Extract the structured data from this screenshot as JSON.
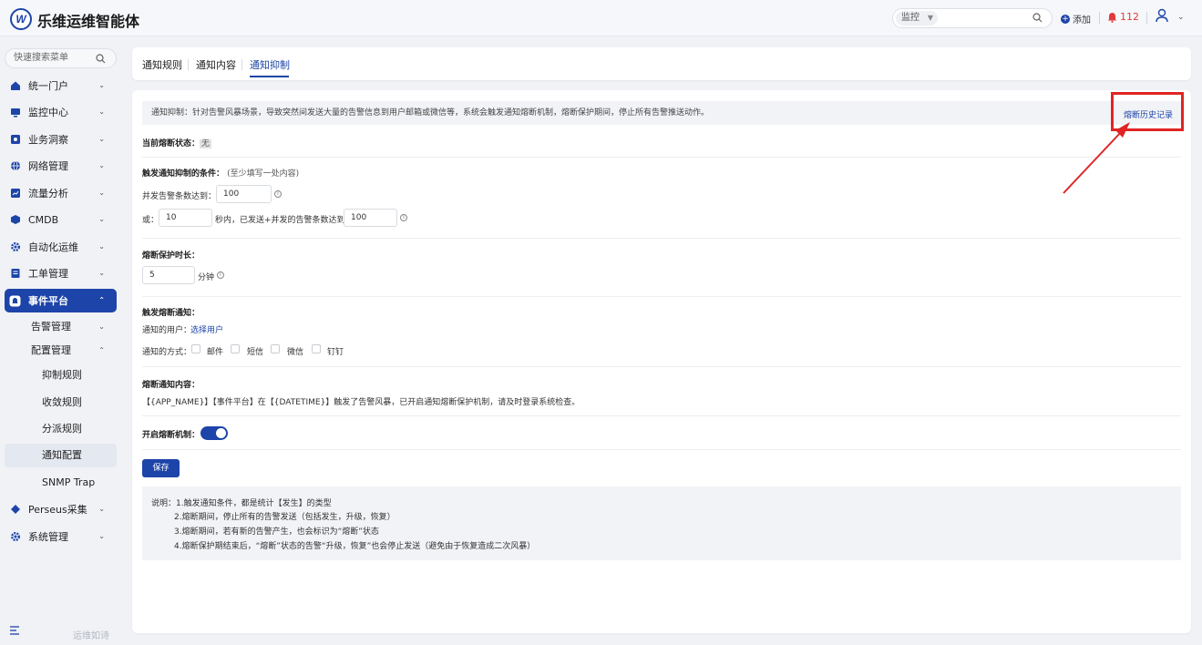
{
  "header": {
    "app_title": "乐维运维智能体",
    "search_scope": "监控",
    "search_placeholder": "",
    "add_label": "添加",
    "alert_count": "112"
  },
  "sidebar": {
    "search_placeholder": "快速搜索菜单",
    "items": [
      {
        "label": "统一门户",
        "icon": "home-icon"
      },
      {
        "label": "监控中心",
        "icon": "monitor-icon"
      },
      {
        "label": "业务洞察",
        "icon": "insight-icon"
      },
      {
        "label": "网络管理",
        "icon": "globe-icon"
      },
      {
        "label": "流量分析",
        "icon": "traffic-chart-icon"
      },
      {
        "label": "CMDB",
        "icon": "cube-icon"
      },
      {
        "label": "自动化运维",
        "icon": "gear-icon"
      },
      {
        "label": "工单管理",
        "icon": "ticket-icon"
      },
      {
        "label": "事件平台",
        "icon": "bell-icon"
      },
      {
        "label": "Perseus采集",
        "icon": "perseus-icon"
      },
      {
        "label": "系统管理",
        "icon": "settings-icon"
      }
    ],
    "sub_items": [
      "告警管理",
      "配置管理"
    ],
    "leaf_items": [
      "抑制规则",
      "收敛规则",
      "分派规则",
      "通知配置",
      "SNMP Trap"
    ],
    "footer_text": "运维如诗"
  },
  "tabs": [
    "通知规则",
    "通知内容",
    "通知抑制"
  ],
  "page": {
    "info_text": "通知抑制：针对告警风暴场景，导致突然间发送大量的告警信息到用户邮箱或微信等，系统会触发通知熔断机制，熔断保护期间，停止所有告警推送动作。",
    "history_link": "熔断历史记录",
    "state_label": "当前熔断状态：",
    "state_value": "无",
    "cond_title": "触发通知抑制的条件：",
    "cond_hint": "(至少填写一处内容)",
    "concurrent_label": "并发告警条数达到：",
    "concurrent_value": "100",
    "or_label": "或：",
    "seconds_value": "10",
    "seconds_suffix": "秒内，已发送+并发的告警条数达到",
    "sent_value": "100",
    "protect_title": "熔断保护时长：",
    "protect_value": "5",
    "protect_unit": "分钟",
    "notify_title": "触发熔断通知：",
    "notify_users_label": "通知的用户：",
    "select_users_link": "选择用户",
    "notify_methods_label": "通知的方式：",
    "methods": [
      "邮件",
      "短信",
      "微信",
      "钉钉"
    ],
    "content_title": "熔断通知内容：",
    "content_text": "【{APP_NAME}】【事件平台】在【{DATETIME}】触发了告警风暴，已开启通知熔断保护机制，请及时登录系统检查。",
    "enable_label": "开启熔断机制：",
    "enable_state": true,
    "save_label": "保存",
    "notes": [
      "说明：1.触发通知条件，都是统计【发生】的类型",
      "2.熔断期间，停止所有的告警发送（包括发生，升级，恢复）",
      "3.熔断期间，若有新的告警产生，也会标识为“熔断”状态",
      "4.熔断保护期结束后，“熔断”状态的告警“升级，恢复”也会停止发送（避免由于恢复造成二次风暴）"
    ]
  },
  "colors": {
    "primary": "#1d44a8",
    "alert": "#e23b3b",
    "annotation": "#e02424"
  }
}
